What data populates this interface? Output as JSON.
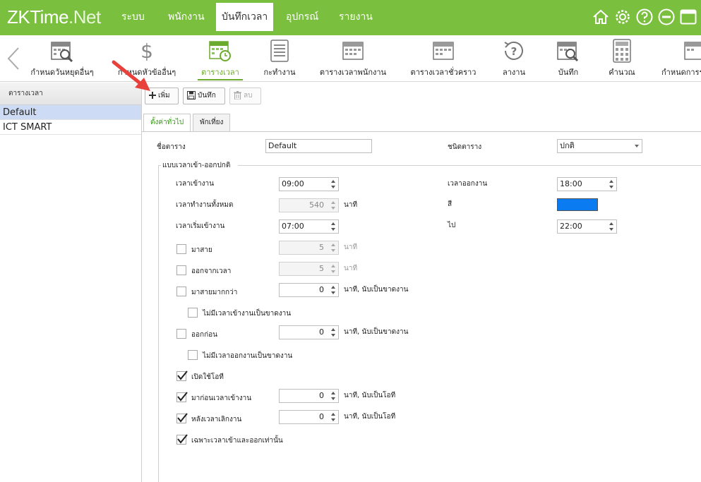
{
  "logo": {
    "zk": "ZKTime",
    "net": ".Net"
  },
  "menu": [
    "ระบบ",
    "พนักงาน",
    "บันทึกเวลา",
    "อุปกรณ์",
    "รายงาน"
  ],
  "colors": {
    "topbar": "#7bbf3f",
    "active_green": "#6aaa2c",
    "selected_row": "#cddcf4",
    "swatch": "#0a7bf0"
  },
  "top_icons": [
    "home-icon",
    "gear-icon",
    "help-icon",
    "minimize-icon",
    "window-icon"
  ],
  "toolbar": [
    {
      "label": "กำหนดวันหยุดอื่นๆ",
      "icon": "calendar-search-icon"
    },
    {
      "label": "กำหนดหัวข้ออื่นๆ",
      "icon": "dollar-icon"
    },
    {
      "label": "ตารางเวลา",
      "icon": "calendar-clock-icon"
    },
    {
      "label": "กะทำงาน",
      "icon": "list-icon"
    },
    {
      "label": "ตารางเวลาพนักงาน",
      "icon": "calendar-icon"
    },
    {
      "label": "ตารางเวลาชั่วคราว",
      "icon": "calendar-icon"
    },
    {
      "label": "ลางาน",
      "icon": "question-refresh-icon"
    },
    {
      "label": "บันทึก",
      "icon": "calendar-search-icon"
    },
    {
      "label": "คำนวณ",
      "icon": "calculator-icon"
    },
    {
      "label": "กำหนดการร",
      "icon": "calendar-icon"
    }
  ],
  "sidebar": {
    "header": "ตารางเวลา",
    "items": [
      "Default",
      "ICT SMART"
    ]
  },
  "actions": {
    "add": "เพิ่ม",
    "save": "บันทึก",
    "delete": "ลบ"
  },
  "tabs": [
    "ตั้งค่าทั่วไป",
    "พักเที่ยง"
  ],
  "form": {
    "name_label": "ชื่อตาราง",
    "name_value": "Default",
    "type_label": "ชนิดตาราง",
    "type_value": "ปกติ",
    "group_title": "แบบเวลาเข้า-ออกปกติ",
    "checkin_label": "เวลาเข้างาน",
    "checkin_value": "09:00",
    "checkout_label": "เวลาออกงาน",
    "checkout_value": "18:00",
    "total_label": "เวลาทำงานทั้งหมด",
    "total_value": "540",
    "minute": "นาที",
    "color_label": "สี",
    "start_label": "เวลาเริ่มเข้างาน",
    "start_value": "07:00",
    "to_label": "ไป",
    "to_value": "22:00",
    "late_label": "มาสาย",
    "late_value": "5",
    "early_label": "ออกจากเวลา",
    "early_value": "5",
    "late_more_label": "มาสายมากกว่า",
    "late_more_value": "0",
    "count_absent": "นาที, นับเป็นขาดงาน",
    "no_checkin_label": "ไม่มีเวลาเข้างานเป็นขาดงาน",
    "leave_early_label": "ออกก่อน",
    "leave_early_value": "0",
    "no_checkout_label": "ไม่มีเวลาออกงานเป็นขาดงาน",
    "ot_enable_label": "เปิดใช้โอที",
    "before_in_label": "มาก่อนเวลาเข้างาน",
    "before_in_value": "0",
    "count_ot": "นาที, นับเป็นโอที",
    "after_out_label": "หลังเวลาเลิกงาน",
    "after_out_value": "0",
    "only_in_out_label": "เฉพาะเวลาเข้าและออกเท่านั้น"
  },
  "checkboxes": {
    "late": false,
    "early": false,
    "late_more": false,
    "no_checkin": false,
    "leave_early": false,
    "no_checkout": false,
    "ot_enable": true,
    "before_in": true,
    "after_out": true,
    "only_in_out": true
  }
}
